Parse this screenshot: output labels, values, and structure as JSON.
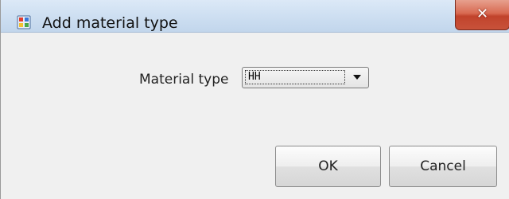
{
  "window": {
    "title": "Add material type",
    "close_glyph": "✕",
    "icon": "application-form-icon"
  },
  "form": {
    "material_type_label": "Material type",
    "material_type_value": "HH"
  },
  "buttons": {
    "ok": "OK",
    "cancel": "Cancel"
  },
  "colors": {
    "close_button": "#c8523a",
    "titlebar": "#cfe0f2",
    "client_background": "#f0f0f0"
  }
}
